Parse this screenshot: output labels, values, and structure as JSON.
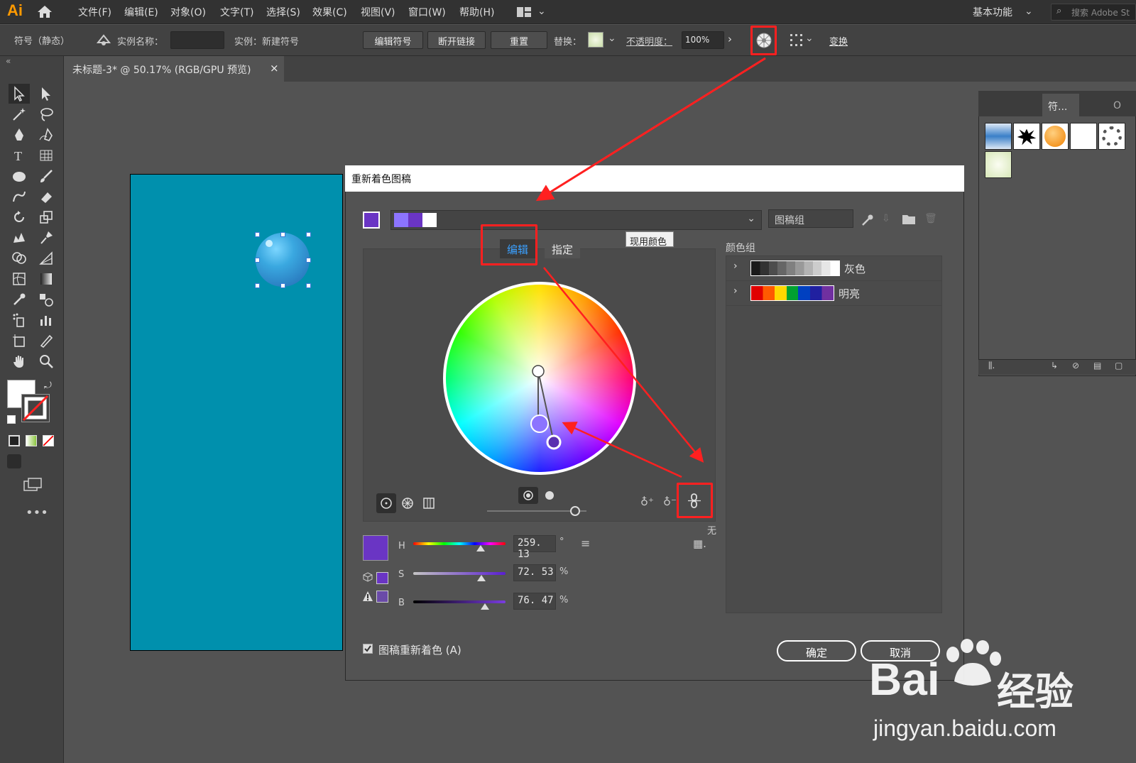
{
  "app": {
    "logo": "Ai"
  },
  "menu": [
    "文件(F)",
    "编辑(E)",
    "对象(O)",
    "文字(T)",
    "选择(S)",
    "效果(C)",
    "视图(V)",
    "窗口(W)",
    "帮助(H)"
  ],
  "workspace": "基本功能",
  "search": {
    "placeholder": "搜索 Adobe St"
  },
  "controlbar": {
    "symbol_state": "符号（静态）",
    "instance_name_label": "实例名称：",
    "instance_label": "实例：新建符号",
    "edit_symbol": "编辑符号",
    "break_link": "断开链接",
    "reset": "重置",
    "replace_label": "替换：",
    "opacity_label": "不透明度：",
    "opacity_value": "100%",
    "transform": "变换"
  },
  "document_tab": {
    "title": "未标题-3* @ 50.17% (RGB/GPU 预览)",
    "close": "×"
  },
  "symbols_panel": {
    "tab": "符...",
    "tab2": "O"
  },
  "dialog": {
    "title": "重新着色图稿",
    "group_field": "图稿组",
    "tooltip": "现用颜色",
    "tab_edit": "编辑",
    "tab_assign": "指定",
    "color_groups_label": "颜色组",
    "color_groups": [
      {
        "name": "灰色",
        "colors": [
          "#1a1a1a",
          "#333",
          "#4d4d4d",
          "#666",
          "#808080",
          "#999",
          "#b3b3b3",
          "#ccc",
          "#e6e6e6",
          "#fff"
        ]
      },
      {
        "name": "明亮",
        "colors": [
          "#e00000",
          "#ff5a00",
          "#ffd800",
          "#00a030",
          "#0040c0",
          "#2020a0",
          "#7030a0"
        ]
      }
    ],
    "none_label": "无",
    "hsb": {
      "h_label": "H",
      "h_value": "259. 13",
      "h_unit": "°",
      "s_label": "S",
      "s_value": "72. 53",
      "s_unit": "%",
      "b_label": "B",
      "b_value": "76. 47",
      "b_unit": "%"
    },
    "recolor_label": "图稿重新着色 (A)",
    "ok": "确定",
    "cancel": "取消",
    "active_color": "#6a35c4"
  },
  "watermark": {
    "brand": "Bai",
    "brand2": "经验",
    "url": "jingyan.baidu.com"
  }
}
